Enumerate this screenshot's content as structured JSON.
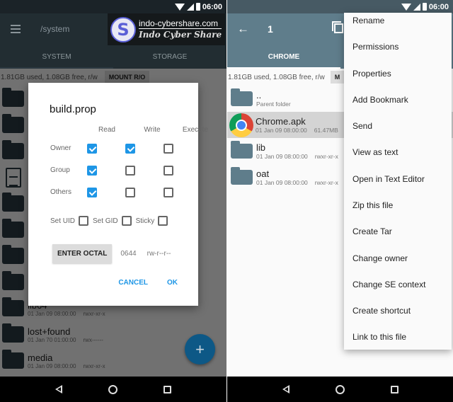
{
  "status_bar": {
    "time": "06:00",
    "icons": [
      "wifi-icon",
      "signal-icon",
      "battery-icon"
    ]
  },
  "left": {
    "path": "/system",
    "watermark": {
      "url": "indo-cybershare.com",
      "name": "Indo Cyber Share",
      "logo_letter": "S"
    },
    "tabs": [
      "SYSTEM",
      "STORAGE"
    ],
    "storage_info": "1.81GB used, 1.08GB free, r/w",
    "mount_label": "MOUNT R/O",
    "files": [
      {
        "type": "folder",
        "name": "",
        "date": "",
        "perms": ""
      },
      {
        "type": "folder",
        "name": "",
        "date": "",
        "perms": ""
      },
      {
        "type": "folder",
        "name": "",
        "date": "",
        "perms": ""
      },
      {
        "type": "file",
        "name": "",
        "date": "",
        "perms": ""
      },
      {
        "type": "folder",
        "name": "",
        "date": "",
        "perms": ""
      },
      {
        "type": "folder",
        "name": "",
        "date": "",
        "perms": ""
      },
      {
        "type": "folder",
        "name": "",
        "date": "",
        "perms": ""
      },
      {
        "type": "folder",
        "name": "",
        "date": "",
        "perms": ""
      },
      {
        "type": "folder",
        "name": "lib64",
        "date": "01 Jan 09 08:00:00",
        "perms": "rwxr-xr-x"
      },
      {
        "type": "folder",
        "name": "lost+found",
        "date": "01 Jan 70 01:00:00",
        "perms": "rwx------"
      },
      {
        "type": "folder",
        "name": "media",
        "date": "01 Jan 09 08:00:00",
        "perms": "rwxr-xr-x"
      }
    ],
    "fab_label": "+",
    "dialog": {
      "title": "build.prop",
      "columns": [
        "Read",
        "Write",
        "Execute"
      ],
      "rows": [
        {
          "label": "Owner",
          "values": [
            true,
            true,
            false
          ]
        },
        {
          "label": "Group",
          "values": [
            true,
            false,
            false
          ]
        },
        {
          "label": "Others",
          "values": [
            true,
            false,
            false
          ]
        }
      ],
      "special": [
        {
          "label": "Set UID",
          "checked": false
        },
        {
          "label": "Set GID",
          "checked": false
        },
        {
          "label": "Sticky",
          "checked": false
        }
      ],
      "enter_octal_label": "ENTER OCTAL",
      "octal_value": "0644",
      "octal_string": "rw-r--r--",
      "cancel_label": "CANCEL",
      "ok_label": "OK",
      "accent_color": "#1e96e6"
    }
  },
  "right": {
    "selection_count": "1",
    "tabs": [
      "CHROME"
    ],
    "storage_info": "1.81GB used, 1.08GB free, r/w",
    "mount_label": "M",
    "files": [
      {
        "type": "folder",
        "name": "..",
        "meta": "Parent folder",
        "perms": ""
      },
      {
        "type": "apk",
        "name": "Chrome.apk",
        "meta": "01 Jan 09 08:00:00",
        "perms": "61.47MB",
        "selected": true
      },
      {
        "type": "folder",
        "name": "lib",
        "meta": "01 Jan 09 08:00:00",
        "perms": "rwxr-xr-x"
      },
      {
        "type": "folder",
        "name": "oat",
        "meta": "01 Jan 09 08:00:00",
        "perms": "rwxr-xr-x"
      }
    ],
    "menu": [
      "Rename",
      "Permissions",
      "Properties",
      "Add Bookmark",
      "Send",
      "View as text",
      "Open in Text Editor",
      "Zip this file",
      "Create Tar",
      "Change owner",
      "Change SE context",
      "Create shortcut",
      "Link to this file"
    ]
  }
}
